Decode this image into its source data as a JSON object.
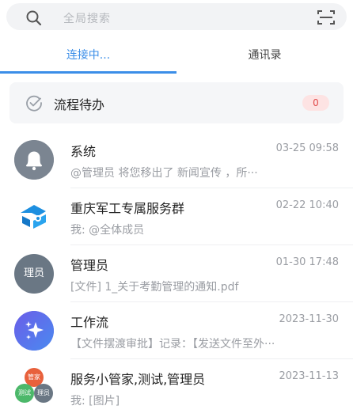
{
  "search": {
    "placeholder": "全局搜索"
  },
  "tabs": [
    {
      "label": "连接中...",
      "active": true
    },
    {
      "label": "通讯录",
      "active": false
    }
  ],
  "todo": {
    "label": "流程待办",
    "count": "0"
  },
  "conversations": [
    {
      "title": "系统",
      "time": "03-25 09:58",
      "preview": "@管理员 将您移出了 新闻宣传 ，所···",
      "avatar": "bell-icon"
    },
    {
      "title": "重庆军工专属服务群",
      "time": "02-22 10:40",
      "preview": "我: @全体成员",
      "avatar": "group-logo-icon"
    },
    {
      "title": "管理员",
      "time": "01-30 17:48",
      "preview": "[文件] 1_关于考勤管理的通知.pdf",
      "avatar_text": "理员"
    },
    {
      "title": "工作流",
      "time": "2023-11-30",
      "preview": "【文件摆渡审批】记录：【发送文件至外···",
      "avatar": "sparkle-icon"
    },
    {
      "title": "服务小管家,测试,管理员",
      "time": "2023-11-13",
      "preview": "我: [图片]",
      "avatar_parts": [
        "管家",
        "测试",
        "理员"
      ]
    }
  ],
  "colors": {
    "accent": "#3b8ee8",
    "badge_bg": "#fde3e3",
    "badge_text": "#e14b4b"
  }
}
